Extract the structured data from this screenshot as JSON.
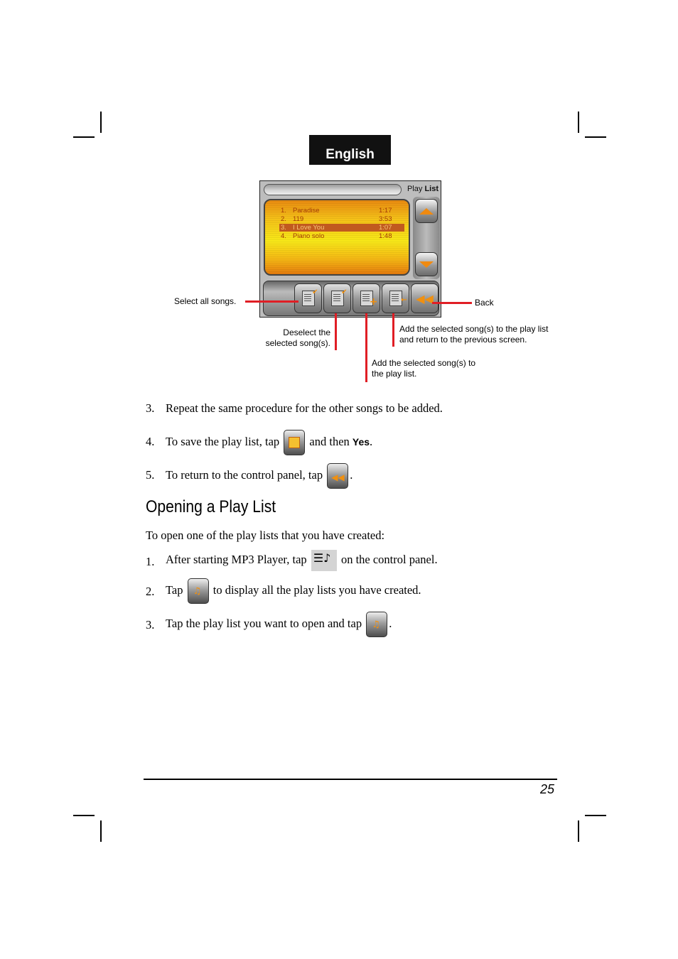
{
  "header": {
    "language_tab": "English"
  },
  "device": {
    "title_prefix": "Play ",
    "title_suffix": "List",
    "songs": [
      {
        "num": "1.",
        "name": "Paradise",
        "duration": "1:17",
        "selected": false
      },
      {
        "num": "2.",
        "name": "119",
        "duration": "3:53",
        "selected": false
      },
      {
        "num": "3.",
        "name": "I Love You",
        "duration": "1:07",
        "selected": true
      },
      {
        "num": "4.",
        "name": "Piano solo",
        "duration": "1:48",
        "selected": false
      }
    ],
    "icons": {
      "scroll_up": "scroll-up-icon",
      "scroll_down": "scroll-down-icon",
      "select_all": "select-all-icon",
      "deselect": "deselect-icon",
      "add": "add-to-playlist-icon",
      "add_return": "add-and-return-icon",
      "back": "back-icon"
    },
    "accent_color": "#f09010",
    "callout_color": "#e01e25"
  },
  "callouts": {
    "select_all": "Select all songs.",
    "deselect_line1": "Deselect the",
    "deselect_line2": "selected song(s).",
    "back": "Back",
    "add_return_line1": "Add the selected song(s) to the play list",
    "add_return_line2": "and return to the previous screen.",
    "add_line1": "Add the selected song(s) to",
    "add_line2": "the play list."
  },
  "steps_a": [
    {
      "n": "3.",
      "text": "Repeat the same procedure for the other songs to be added."
    },
    {
      "n": "4.",
      "before": "To save the play list, tap",
      "after": " and then ",
      "bold": "Yes",
      "end": "."
    },
    {
      "n": "5.",
      "before": "To return to the control panel, tap",
      "end": "."
    }
  ],
  "section": {
    "heading": "Opening a Play List",
    "intro": "To open one of the play lists that you have created:",
    "steps": [
      {
        "n": "1.",
        "before": "After starting MP3 Player, tap",
        "after": " on the control panel."
      },
      {
        "n": "2.",
        "before": "Tap",
        "after": " to display all the play lists you have created."
      },
      {
        "n": "3.",
        "before": "Tap the play list you want to open and tap",
        "end": "."
      }
    ]
  },
  "footer": {
    "page_number": "25"
  }
}
